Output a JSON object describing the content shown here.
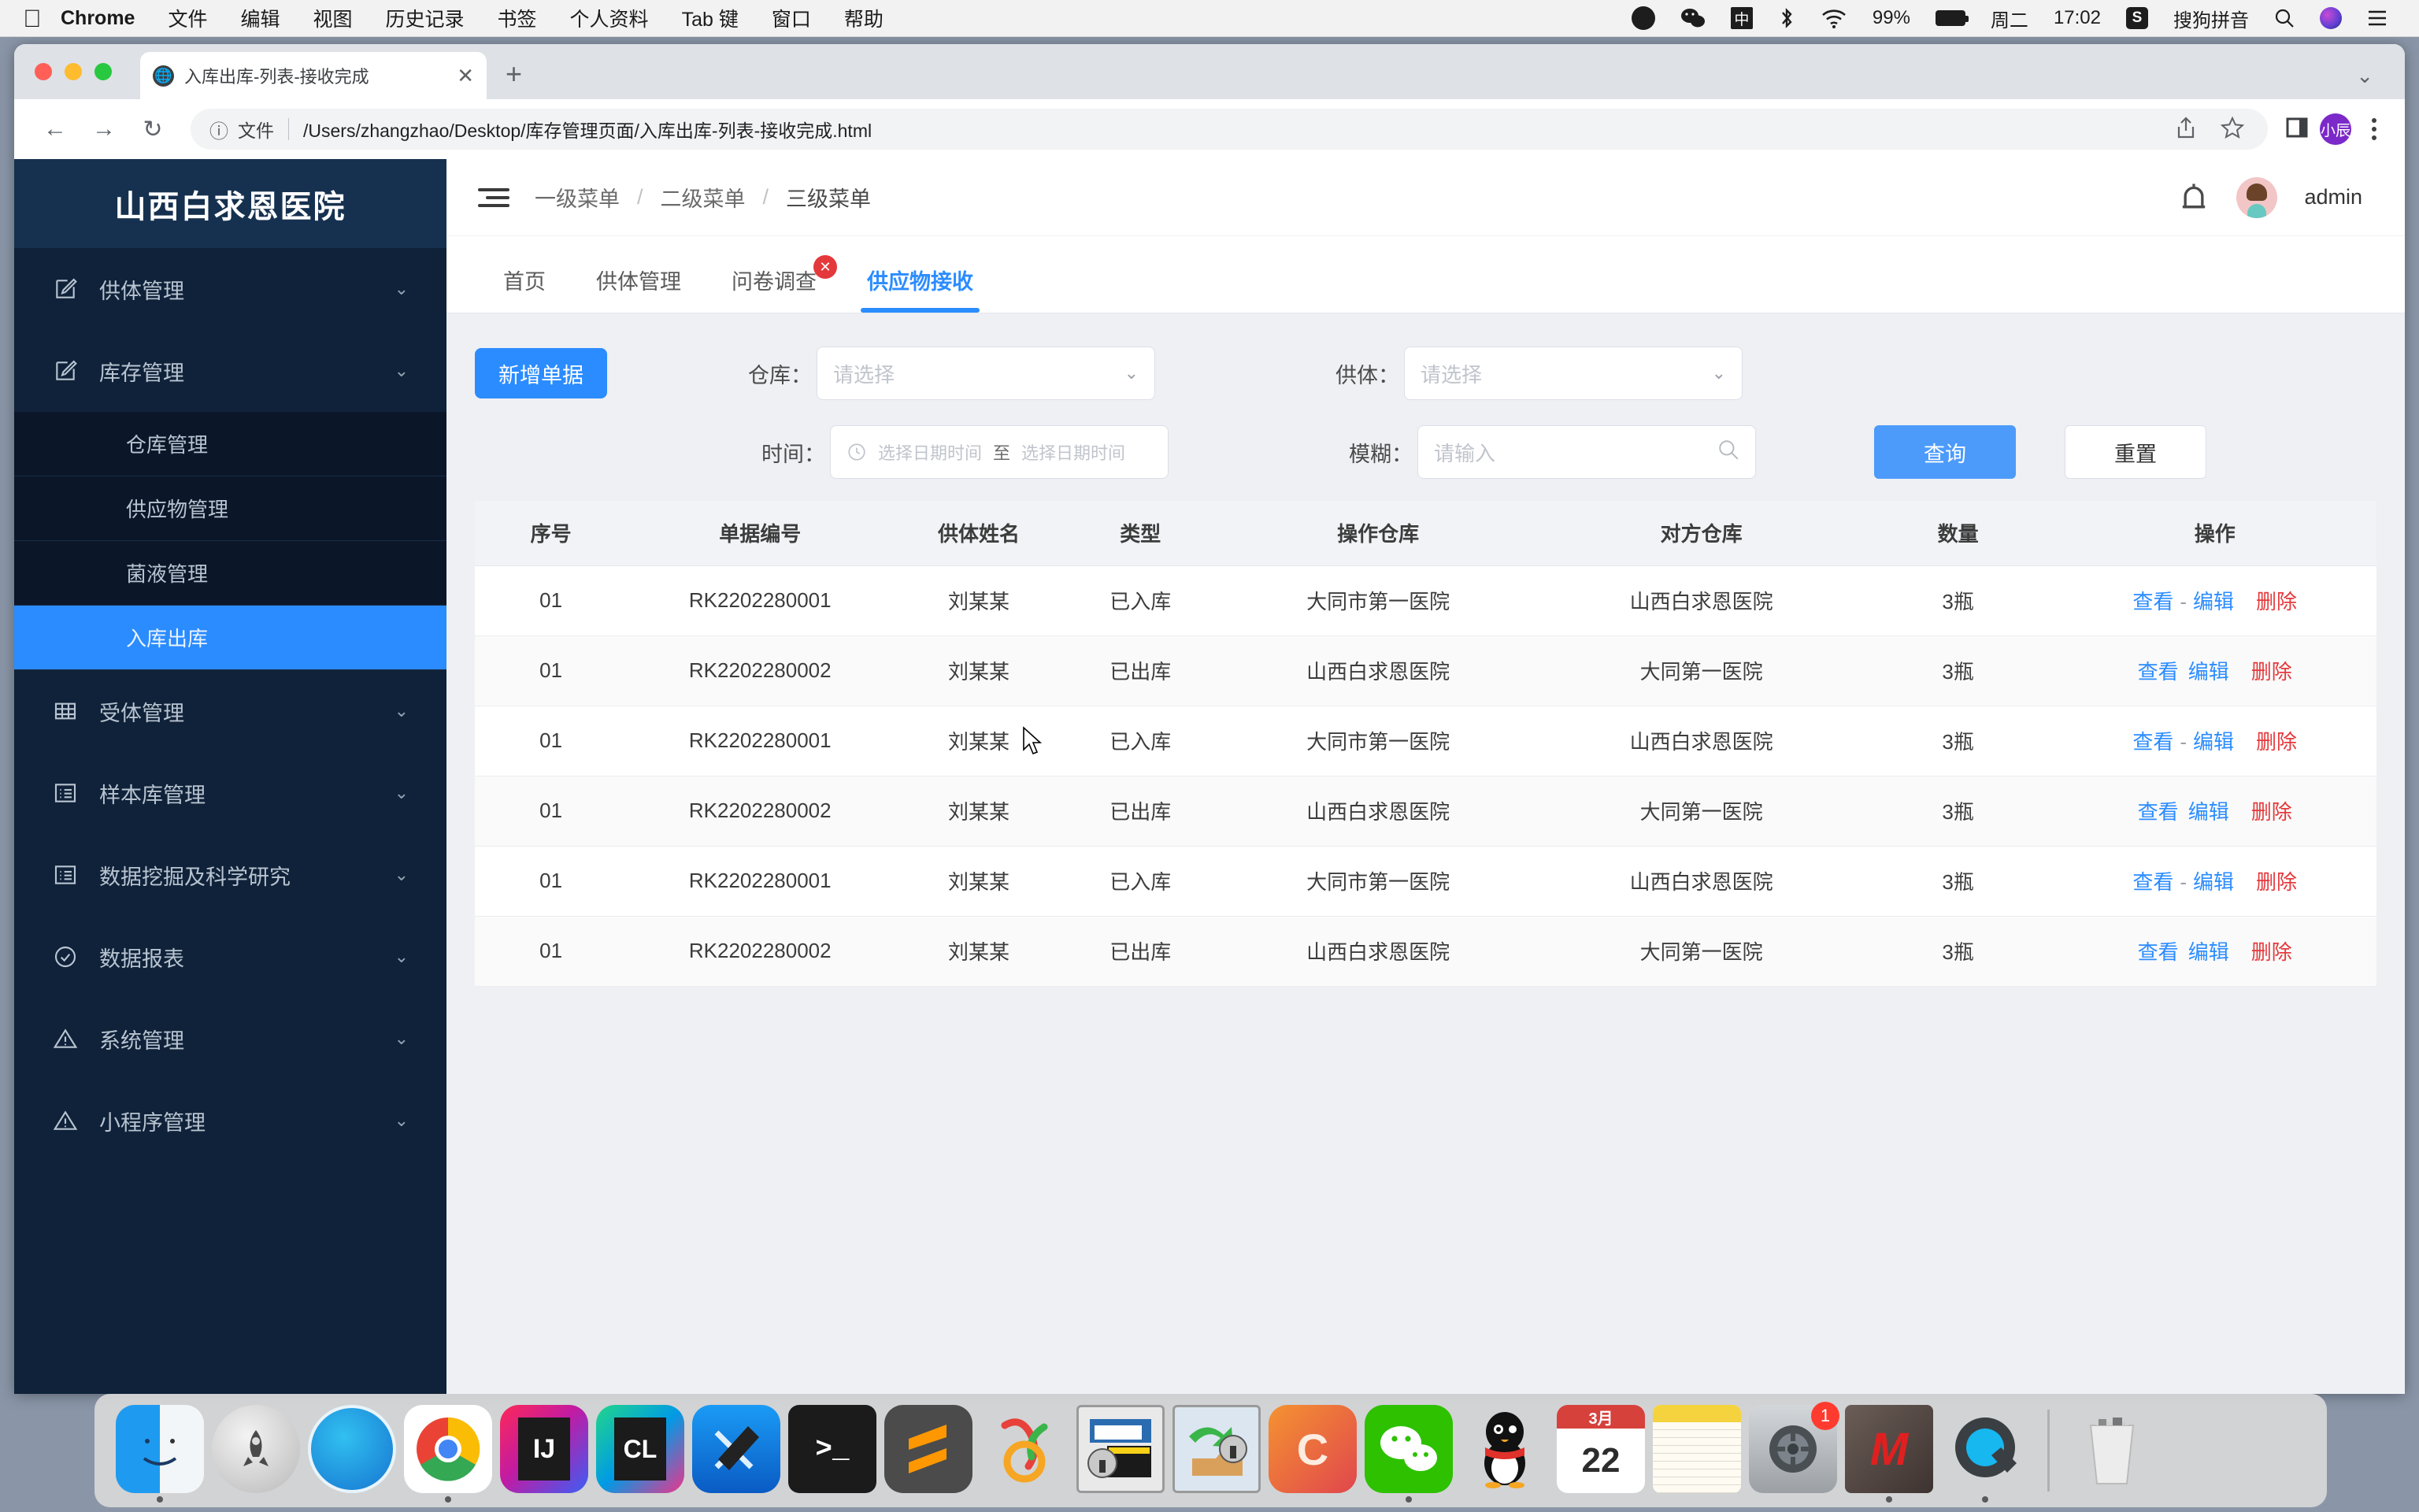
{
  "menubar": {
    "apple_icon": "apple-logo",
    "items": [
      "Chrome",
      "文件",
      "编辑",
      "视图",
      "历史记录",
      "书签",
      "个人资料",
      "Tab 键",
      "窗口",
      "帮助"
    ],
    "status": {
      "battery_percent": "99%",
      "day": "周二",
      "time": "17:02",
      "input_method": "搜狗拼音",
      "icons": [
        "opera-icon",
        "wechat-icon",
        "input-cn-icon",
        "bluetooth-icon",
        "wifi-icon",
        "battery-icon",
        "sogou-icon",
        "spotlight-search-icon",
        "siri-icon",
        "control-center-icon"
      ]
    }
  },
  "browser": {
    "tab_title": "入库出库-列表-接收完成",
    "new_tab_label": "+",
    "close_tab_label": "✕",
    "omnibox": {
      "file_label": "文件",
      "url": "/Users/zhangzhao/Desktop/库存管理页面/入库出库-列表-接收完成.html"
    },
    "profile_initials": "小辰"
  },
  "sidebar": {
    "brand": "山西白求恩医院",
    "items": [
      {
        "label": "供体管理",
        "icon": "edit-square-icon",
        "expandable": true
      },
      {
        "label": "库存管理",
        "icon": "edit-square-icon",
        "expandable": true
      }
    ],
    "sub_items": [
      {
        "label": "仓库管理",
        "active": false
      },
      {
        "label": "供应物管理",
        "active": false
      },
      {
        "label": "菌液管理",
        "active": false
      },
      {
        "label": "入库出库",
        "active": true
      }
    ],
    "items_after": [
      {
        "label": "受体管理",
        "icon": "table-grid-icon",
        "expandable": true
      },
      {
        "label": "样本库管理",
        "icon": "list-box-icon",
        "expandable": true
      },
      {
        "label": "数据挖掘及科学研究",
        "icon": "list-box-icon",
        "expandable": true
      },
      {
        "label": "数据报表",
        "icon": "check-circle-icon",
        "expandable": true
      },
      {
        "label": "系统管理",
        "icon": "warning-triangle-icon",
        "expandable": true
      },
      {
        "label": "小程序管理",
        "icon": "warning-triangle-icon",
        "expandable": true
      }
    ],
    "chevron": "⌄"
  },
  "topbar": {
    "menu_toggle_icon": "hamburger-collapse-icon",
    "breadcrumbs": [
      "一级菜单",
      "二级菜单",
      "三级菜单"
    ],
    "separator": "/",
    "bell_icon": "notification-bell-icon",
    "username": "admin"
  },
  "page_tabs": [
    {
      "label": "首页",
      "active": false,
      "closable": false
    },
    {
      "label": "供体管理",
      "active": false,
      "closable": false
    },
    {
      "label": "问卷调查",
      "active": false,
      "closable": true,
      "badge": "✕"
    },
    {
      "label": "供应物接收",
      "active": true,
      "closable": false
    }
  ],
  "filters": {
    "add_button": "新增单据",
    "warehouse_label": "仓库：",
    "warehouse_placeholder": "请选择",
    "donor_label": "供体：",
    "donor_placeholder": "请选择",
    "time_label": "时间：",
    "time_start_placeholder": "选择日期时间",
    "time_to": "至",
    "time_end_placeholder": "选择日期时间",
    "fuzzy_label": "模糊：",
    "fuzzy_placeholder": "请输入",
    "search_button": "查询",
    "reset_button": "重置",
    "clock_icon": "clock-icon",
    "search_icon": "magnifier-icon",
    "caret_icon": "chevron-down-icon"
  },
  "table": {
    "headers": [
      "序号",
      "单据编号",
      "供体姓名",
      "类型",
      "操作仓库",
      "对方仓库",
      "数量",
      "操作"
    ],
    "actions": {
      "view": "查看",
      "edit": "编辑",
      "delete": "删除",
      "separator": "-"
    },
    "rows": [
      {
        "seq": "01",
        "doc_no": "RK2202280001",
        "donor": "刘某某",
        "type": "已入库",
        "op_warehouse": "大同市第一医院",
        "counter_warehouse": "山西白求恩医院",
        "qty": "3瓶",
        "sep": true
      },
      {
        "seq": "01",
        "doc_no": "RK2202280002",
        "donor": "刘某某",
        "type": "已出库",
        "op_warehouse": "山西白求恩医院",
        "counter_warehouse": "大同第一医院",
        "qty": "3瓶",
        "sep": false
      },
      {
        "seq": "01",
        "doc_no": "RK2202280001",
        "donor": "刘某某",
        "type": "已入库",
        "op_warehouse": "大同市第一医院",
        "counter_warehouse": "山西白求恩医院",
        "qty": "3瓶",
        "sep": true
      },
      {
        "seq": "01",
        "doc_no": "RK2202280002",
        "donor": "刘某某",
        "type": "已出库",
        "op_warehouse": "山西白求恩医院",
        "counter_warehouse": "大同第一医院",
        "qty": "3瓶",
        "sep": false
      },
      {
        "seq": "01",
        "doc_no": "RK2202280001",
        "donor": "刘某某",
        "type": "已入库",
        "op_warehouse": "大同市第一医院",
        "counter_warehouse": "山西白求恩医院",
        "qty": "3瓶",
        "sep": true
      },
      {
        "seq": "01",
        "doc_no": "RK2202280002",
        "donor": "刘某某",
        "type": "已出库",
        "op_warehouse": "山西白求恩医院",
        "counter_warehouse": "大同第一医院",
        "qty": "3瓶",
        "sep": false
      }
    ]
  },
  "dock": {
    "items": [
      {
        "name": "finder",
        "label": "",
        "running": true
      },
      {
        "name": "launchpad",
        "label": "",
        "running": false
      },
      {
        "name": "safari",
        "label": "",
        "running": false
      },
      {
        "name": "chrome",
        "label": "",
        "running": true
      },
      {
        "name": "intellij-idea",
        "label": "IJ",
        "running": false
      },
      {
        "name": "clion",
        "label": "CL",
        "running": false
      },
      {
        "name": "xcode",
        "label": "",
        "running": false
      },
      {
        "name": "terminal",
        "label": ">_",
        "running": false
      },
      {
        "name": "sublime-text",
        "label": "S",
        "running": false
      },
      {
        "name": "navicat",
        "label": "",
        "running": false
      },
      {
        "name": "securecrt",
        "label": "",
        "running": false
      },
      {
        "name": "securefx",
        "label": "",
        "running": false
      },
      {
        "name": "cornerstone",
        "label": "C",
        "running": false
      },
      {
        "name": "wechat",
        "label": "",
        "running": true
      },
      {
        "name": "qq",
        "label": "",
        "running": false
      },
      {
        "name": "calendar",
        "label": "22",
        "sublabel": "3月",
        "running": false
      },
      {
        "name": "notes",
        "label": "",
        "running": false
      },
      {
        "name": "system-preferences",
        "label": "",
        "badge": "1",
        "running": false
      },
      {
        "name": "mweb",
        "label": "M",
        "running": true
      },
      {
        "name": "quicktime",
        "label": "Q",
        "running": true
      }
    ],
    "trash": {
      "name": "trash",
      "label": ""
    }
  },
  "colors": {
    "accent_blue": "#2b8cff",
    "sidebar_bg": "#0f2239",
    "sidebar_brand_bg": "#16314f",
    "danger_red": "#e4393c",
    "content_bg": "#eef0f4"
  }
}
